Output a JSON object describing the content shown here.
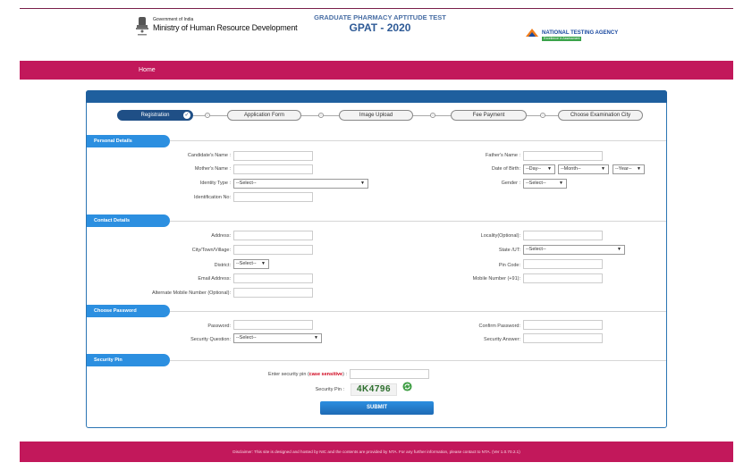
{
  "header": {
    "gov_small": "Government of India",
    "ministry": "Ministry of Human Resource Development",
    "title": "GRADUATE PHARMACY APTITUDE TEST",
    "subtitle": "GPAT - 2020",
    "agency": "NATIONAL TESTING AGENCY",
    "agency_tag": "Excellence in Assessment"
  },
  "nav": {
    "home": "Home"
  },
  "steps": [
    {
      "label": "Registration"
    },
    {
      "label": "Application Form"
    },
    {
      "label": "Image Upload"
    },
    {
      "label": "Fee Payment"
    },
    {
      "label": "Choose Examination City"
    }
  ],
  "sections": {
    "personal": "Personal Details",
    "contact": "Contact Details",
    "password": "Choose Password",
    "pin": "Security Pin"
  },
  "personal": {
    "candidate_name": "Candidate's Name :",
    "father_name": "Father's Name :",
    "mother_name": "Mother's Name :",
    "dob": "Date of Birth:",
    "dob_day": "--Day--",
    "dob_month": "--Month--",
    "dob_year": "--Year--",
    "identity_type": "Identity Type :",
    "identity_type_value": "--Select--",
    "gender": "Gender :",
    "gender_value": "--Select--",
    "identification_no": "Identification No:"
  },
  "contact": {
    "address": "Address:",
    "locality": "Locality(Optional):",
    "city": "City/Town/Village:",
    "state": "State /UT:",
    "state_value": "--Select--",
    "district": "District:",
    "district_value": "--Select--",
    "pin_code": "Pin Code:",
    "email": "Email Address:",
    "mobile": "Mobile Number (+91):",
    "alt_mobile": "Alternate Mobile Number (Optional):"
  },
  "password": {
    "password": "Password:",
    "confirm": "Confirm Password:",
    "question": "Security Question:",
    "question_value": "--Select--",
    "answer": "Security Answer:"
  },
  "pin": {
    "enter_prefix": "Enter security pin (",
    "enter_red": "case sensitive",
    "enter_suffix": ") :",
    "label": "Security Pin :",
    "code": "4K4796",
    "submit": "SUBMIT"
  },
  "footer": {
    "text": "Disclaimer: This site is designed and hosted by NIC and the contents are provided by NTA. For any further information, please contact to NTA. (Ver 1.0.70.2.1)"
  },
  "colors": {
    "brand_magenta": "#c2185b",
    "brand_blue": "#1e5f9e",
    "section_blue": "#2c8fe0"
  }
}
